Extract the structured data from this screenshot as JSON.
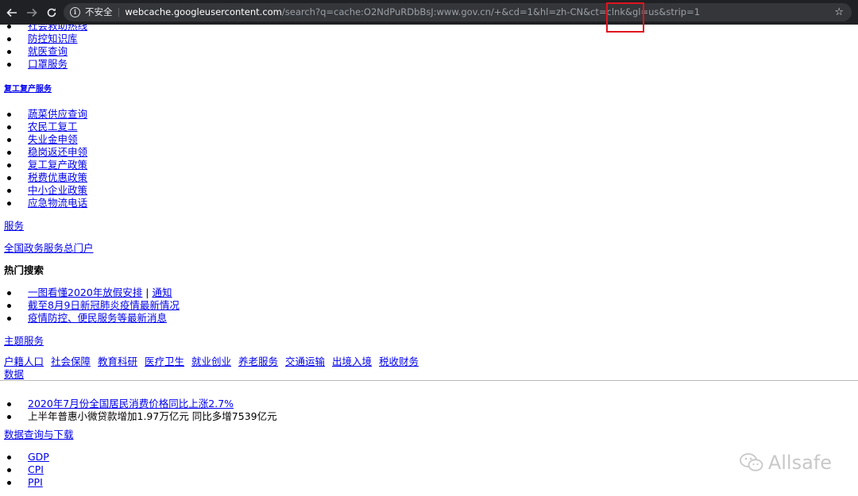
{
  "browser": {
    "security_label": "不安全",
    "url_host": "webcache.googleusercontent.com",
    "url_rest": "/search?q=cache:O2NdPuRDbBsJ:www.gov.cn/+&cd=1&hl=zh-CN&ct=clnk&gl=us&strip=1",
    "star_glyph": "☆"
  },
  "page": {
    "top_list": [
      "社会救助热线",
      "防控知识库",
      "就医查询",
      "口罩服务"
    ],
    "resume_heading": "复工复产服务",
    "resume_list": [
      "蔬菜供应查询",
      "农民工复工",
      "失业金申领",
      "稳岗返还申领",
      "复工复产政策",
      "税费优惠政策",
      "中小企业政策",
      "应急物流电话"
    ],
    "services_link": "服务",
    "portal_link": "全国政务服务总门户",
    "hot_search_title": "热门搜索",
    "hot_list": [
      {
        "a": "一图看懂2020年放假安排",
        "sep": " | ",
        "b": "通知"
      },
      {
        "a": "截至8月9日新冠肺炎疫情最新情况"
      },
      {
        "a": "疫情防控、便民服务等最新消息"
      }
    ],
    "topic_services_link": "主题服务",
    "categories": [
      "户籍人口",
      "社会保障",
      "教育科研",
      "医疗卫生",
      "就业创业",
      "养老服务",
      "交通运输",
      "出境入境",
      "税收财务"
    ],
    "data_link": "数据",
    "data_list": [
      {
        "text": "2020年7月份全国居民消费价格同比上涨2.7%",
        "link": true
      },
      {
        "text": "上半年普惠小微贷款增加1.97万亿元 同比多增7539亿元",
        "link": false
      }
    ],
    "data_query_link": "数据查询与下载",
    "stats_list": [
      "GDP",
      "CPI",
      "PPI"
    ]
  },
  "watermark": {
    "text": "Allsafe",
    "icon": "wechat-icon"
  },
  "colors": {
    "link": "#0000ee",
    "browser_bar": "#202124",
    "highlight": "#e0141e"
  }
}
